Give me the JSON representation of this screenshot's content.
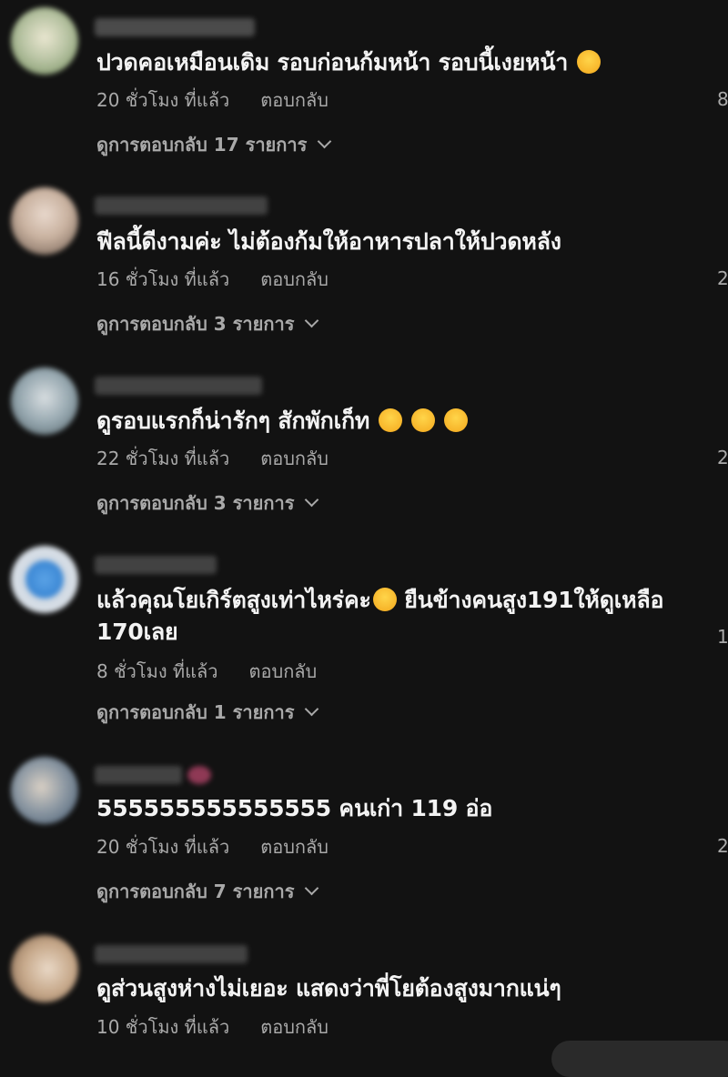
{
  "comments": [
    {
      "text": "ปวดคอเหมือนเดิม รอบก่อนก้มหน้า รอบนี้เงยหน้า",
      "emojis": [
        "laughing"
      ],
      "time": "20 ชั่วโมง ที่แล้ว",
      "reply": "ตอบกลับ",
      "view_replies": "ดูการตอบกลับ 17 รายการ",
      "side_count": "8"
    },
    {
      "text": "ฟีลนี้ดีงามค่ะ ไม่ต้องก้มให้อาหารปลาให้ปวดหลัง",
      "emojis": [],
      "time": "16 ชั่วโมง ที่แล้ว",
      "reply": "ตอบกลับ",
      "view_replies": "ดูการตอบกลับ 3 รายการ",
      "side_count": "2"
    },
    {
      "text": "ดูรอบแรกก็น่ารักๆ สักพักเก็ท",
      "emojis": [
        "sweat-smile",
        "sweat-smile",
        "sweat-smile"
      ],
      "time": "22 ชั่วโมง ที่แล้ว",
      "reply": "ตอบกลับ",
      "view_replies": "ดูการตอบกลับ 3 รายการ",
      "side_count": "2"
    },
    {
      "text": "แล้วคุณโยเกิร์ตสูงเท่าไหร่คะ",
      "text_after_emoji": " ยืนข้างคนสูง191ให้ดูเหลือ",
      "text_line2": "170เลย",
      "emojis": [
        "scream"
      ],
      "time": "8 ชั่วโมง ที่แล้ว",
      "reply": "ตอบกลับ",
      "view_replies": "ดูการตอบกลับ 1 รายการ",
      "side_count": "1"
    },
    {
      "text": "555555555555555 คนเก่า 119 อ่อ",
      "emojis": [],
      "time": "20 ชั่วโมง ที่แล้ว",
      "reply": "ตอบกลับ",
      "view_replies": "ดูการตอบกลับ 7 รายการ",
      "side_count": "2"
    },
    {
      "text": "ดูส่วนสูงห่างไม่เยอะ แสดงว่าพี่โยต้องสูงมากแน่ๆ",
      "emojis": [],
      "time": "10 ชั่วโมง ที่แล้ว",
      "reply": "ตอบกลับ",
      "side_count": ""
    }
  ],
  "colors": {
    "background": "#121212",
    "text": "#f3f3f3",
    "muted": "#a9a9a9"
  }
}
